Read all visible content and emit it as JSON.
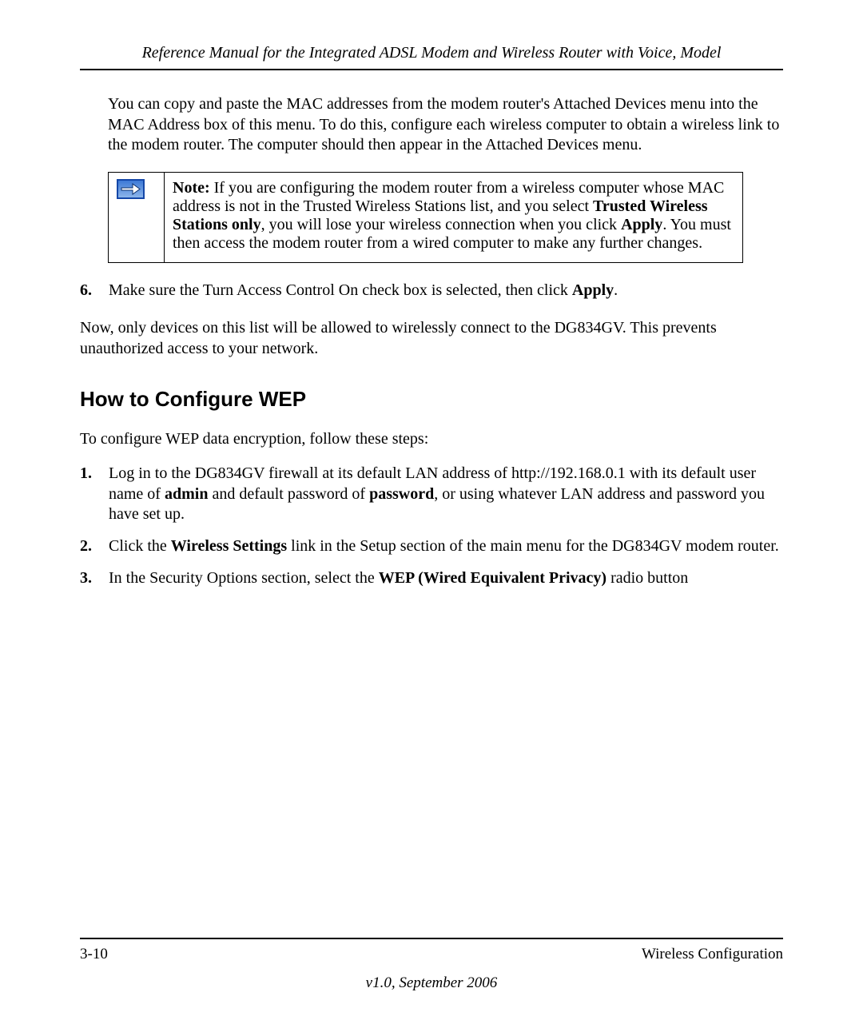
{
  "header": {
    "title": "Reference Manual for the Integrated ADSL Modem and Wireless Router with Voice, Model"
  },
  "intro_para": "You can copy and paste the MAC addresses from the modem router's Attached Devices menu into the MAC Address box of this menu. To do this, configure each wireless computer to obtain a wireless link to the modem router. The computer should then appear in the Attached Devices menu.",
  "note": {
    "label": "Note:",
    "seg1": " If you are configuring the modem router from a wireless computer whose MAC address is not in the Trusted Wireless Stations list, and you select ",
    "bold1": "Trusted Wireless Stations only",
    "seg2": ", you will lose your wireless connection when you click ",
    "bold2": "Apply",
    "seg3": ". You must then access the modem router from a wired computer to make any further changes."
  },
  "step6": {
    "num": "6.",
    "seg1": "Make sure the Turn Access Control On check box is selected, then click ",
    "bold1": "Apply",
    "seg2": "."
  },
  "after_step6": "Now, only devices on this list will be allowed to wirelessly connect to the DG834GV. This prevents unauthorized access to your network.",
  "section_heading": "How to Configure WEP",
  "wep_intro": "To configure WEP data encryption, follow these steps:",
  "wep_steps": {
    "s1": {
      "num": "1.",
      "seg1": "Log in to the DG834GV firewall at its default LAN address of http://192.168.0.1 with its default user name of ",
      "bold1": "admin",
      "seg2": " and default password of ",
      "bold2": "password",
      "seg3": ", or using whatever LAN address and password you have set up."
    },
    "s2": {
      "num": "2.",
      "seg1": "Click the ",
      "bold1": "Wireless Settings",
      "seg2": " link in the Setup section of the main menu for the DG834GV modem router."
    },
    "s3": {
      "num": "3.",
      "seg1": "In the Security Options section, select the ",
      "bold1": "WEP (Wired Equivalent Privacy)",
      "seg2": " radio button"
    }
  },
  "footer": {
    "left": "3-10",
    "right": "Wireless Configuration",
    "version": "v1.0, September 2006"
  }
}
